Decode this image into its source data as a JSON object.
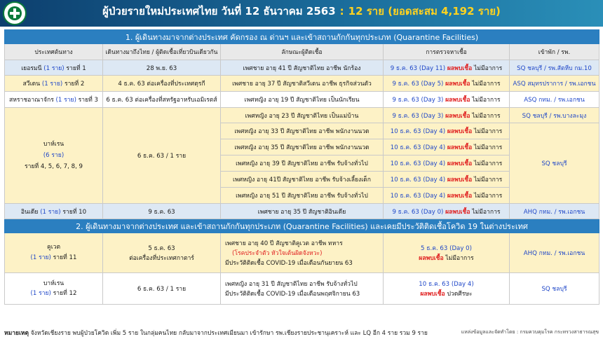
{
  "header": {
    "title": "ผู้ป่วยรายใหม่ประเทศไทย วันที่ 12 ธันวาคม 2563",
    "separator": ":",
    "count": "12 ราย (ยอดสะสม 4,192 ราย)"
  },
  "section1": {
    "title": "1. ผู้เดินทางมาจากต่างประเทศ คัดกรอง ณ ด่านฯ และเข้าสถานกักกันทุกประเภท (Quarantine Facilities)"
  },
  "columns": {
    "origin": "ประเทศต้นทาง",
    "arrival": "เดินทางมาถึงไทย / ผู้ติดเชื้อเที่ยวบินเดียวกัน",
    "patient": "ลักษณะผู้ติดเชื้อ",
    "test": "การตรวจหาเชื้อ",
    "facility": "เข้าพัก / รพ."
  },
  "rows": {
    "germany": {
      "country": "เยอรมนี",
      "cases": "(1 ราย)",
      "rank": "รายที่ 1",
      "arrival": "28 พ.ย. 63",
      "patient": "เพศชาย อายุ 41 ปี สัญชาติไทย อาชีพ นักร้อง",
      "test_date": "9 ธ.ค. 63 (Day 11)",
      "test_result": "ผลพบเชื้อ",
      "symptom": "ไม่มีอาการ",
      "facility": "SQ ชลบุรี / รพ.สัตหีบ กม.10"
    },
    "sweden": {
      "country": "สวีเดน",
      "cases": "(1 ราย)",
      "rank": "รายที่ 2",
      "arrival": "4 ธ.ค. 63 ต่อเครื่องที่ประเทศตุรกี",
      "patient": "เพศชาย อายุ 37 ปี สัญชาติสวีเดน อาชีพ ธุรกิจส่วนตัว",
      "test_date": "9 ธ.ค. 63 (Day 5)",
      "test_result": "ผลพบเชื้อ",
      "symptom": "ไม่มีอาการ",
      "facility": "ASQ สมุทรปราการ / รพ.เอกชน"
    },
    "uk": {
      "country": "สหราชอาณาจักร",
      "cases": "(1 ราย)",
      "rank": "รายที่ 3",
      "arrival": "6 ธ.ค. 63 ต่อเครื่องที่สหรัฐอาหรับเอมิเรตส์",
      "patient": "เพศหญิง อายุ 19 ปี สัญชาติไทย เป็นนักเรียน",
      "test_date": "9 ธ.ค. 63 (Day 3)",
      "test_result": "ผลพบเชื้อ",
      "symptom": "ไม่มีอาการ",
      "facility": "ASQ กทม. / รพ.เอกชน"
    },
    "bahrain": {
      "country": "บาห์เรน",
      "cases": "(6 ราย)",
      "rank": "รายที่ 4, 5, 6, 7, 8, 9",
      "arrival": "6 ธ.ค. 63 / 1 ราย",
      "facility_first": "SQ ชลบุรี / รพ.บางละมุง",
      "facility": "SQ ชลบุรี",
      "people": [
        {
          "patient": "เพศหญิง อายุ 23 ปี สัญชาติไทย เป็นแม่บ้าน",
          "test_date": "9 ธ.ค. 63 (Day 3)",
          "test_result": "ผลพบเชื้อ",
          "symptom": "ไม่มีอาการ"
        },
        {
          "patient": "เพศหญิง อายุ 33 ปี สัญชาติไทย อาชีพ พนักงานนวด",
          "test_date": "10 ธ.ค. 63 (Day 4)",
          "test_result": "ผลพบเชื้อ",
          "symptom": "ไม่มีอาการ"
        },
        {
          "patient": "เพศหญิง อายุ 35 ปี สัญชาติไทย อาชีพ พนักงานนวด",
          "test_date": "10 ธ.ค. 63 (Day 4)",
          "test_result": "ผลพบเชื้อ",
          "symptom": "ไม่มีอาการ"
        },
        {
          "patient": "เพศหญิง อายุ 39 ปี สัญชาติไทย อาชีพ รับจ้างทั่วไป",
          "test_date": "10 ธ.ค. 63 (Day 4)",
          "test_result": "ผลพบเชื้อ",
          "symptom": "ไม่มีอาการ"
        },
        {
          "patient": "เพศหญิง อายุ 41ปี สัญชาติไทย อาชีพ รับจ้างเลี้ยงเด็ก",
          "test_date": "10 ธ.ค. 63 (Day 4)",
          "test_result": "ผลพบเชื้อ",
          "symptom": "ไม่มีอาการ"
        },
        {
          "patient": "เพศหญิง อายุ 51 ปี สัญชาติไทย อาชีพ รับจ้างทั่วไป",
          "test_date": "10 ธ.ค. 63 (Day 4)",
          "test_result": "ผลพบเชื้อ",
          "symptom": "ไม่มีอาการ"
        }
      ]
    },
    "india": {
      "country": "อินเดีย",
      "cases": "(1 ราย)",
      "rank": "รายที่ 10",
      "arrival": "9 ธ.ค. 63",
      "patient": "เพศชาย อายุ 35 ปี สัญชาติอินเดีย",
      "test_date": "9 ธ.ค. 63 (Day 0)",
      "test_result": "ผลพบเชื้อ",
      "symptom": "ไม่มีอาการ",
      "facility": "AHQ กทม. / รพ.เอกชน"
    }
  },
  "section2": {
    "title": "2. ผู้เดินทางมาจากต่างประเทศ และเข้าสถานกักกันทุกประเภท (Quarantine Facilities) และเคยมีประวัติติดเชื้อโควิด 19 ในต่างประเทศ"
  },
  "rows2": {
    "kuwait": {
      "country": "คูเวต",
      "cases": "(1 ราย)",
      "rank": "รายที่ 11",
      "arrival_line1": "5 ธ.ค. 63",
      "arrival_line2": "ต่อเครื่องที่ประเทศกาตาร์",
      "patient_line1": "เพศชาย อายุ 40 ปี สัญชาติคูเวต อาชีพ ทหาร",
      "patient_line2": "(โรคประจำตัว หัวใจเต้นผิดจังหวะ)",
      "patient_line3": "มีประวัติติดเชื้อ COVID-19 เมื่อเดือนกันยายน 63",
      "test_date": "5 ธ.ค. 63 (Day 0)",
      "test_result": "ผลพบเชื้อ",
      "symptom": "ไม่มีอาการ",
      "facility": "AHQ กทม. / รพ.เอกชน"
    },
    "bahrain2": {
      "country": "บาห์เรน",
      "cases": "(1 ราย)",
      "rank": "รายที่ 12",
      "arrival": "6 ธ.ค. 63 / 1 ราย",
      "patient_line1": "เพศหญิง อายุ 31 ปี สัญชาติไทย อาชีพ รับจ้างทั่วไป",
      "patient_line2": "มีประวัติติดเชื้อ COVID-19 เมื่อเดือนพฤศจิกายน 63",
      "test_date": "10 ธ.ค. 63 (Day 4)",
      "test_result": "ผลพบเชื้อ",
      "symptom": "ปวดศีรษะ",
      "facility": "SQ ชลบุรี"
    }
  },
  "footer": {
    "label": "หมายเหตุ",
    "note": "จังหวัดเชียงราย พบผู้ป่วยโควิด เพิ่ม 5 ราย ในกลุ่มคนไทย กลับมาจากประเทศเมียนมา เข้ารักษา รพ.เชียงรายประชานุเคราะห์ และ LQ อีก 4 ราย รวม 9 ราย",
    "source": "แหล่งข้อมูลและจัดทำโดย : กรมควบคุมโรค กระทรวงสาธารณสุข"
  },
  "colors": {
    "header_bg": "#1a6b9a",
    "section_bg": "#2b7fc0",
    "highlight": "#ffd21f",
    "positive": "#e02020",
    "location": "#1f47c8"
  }
}
